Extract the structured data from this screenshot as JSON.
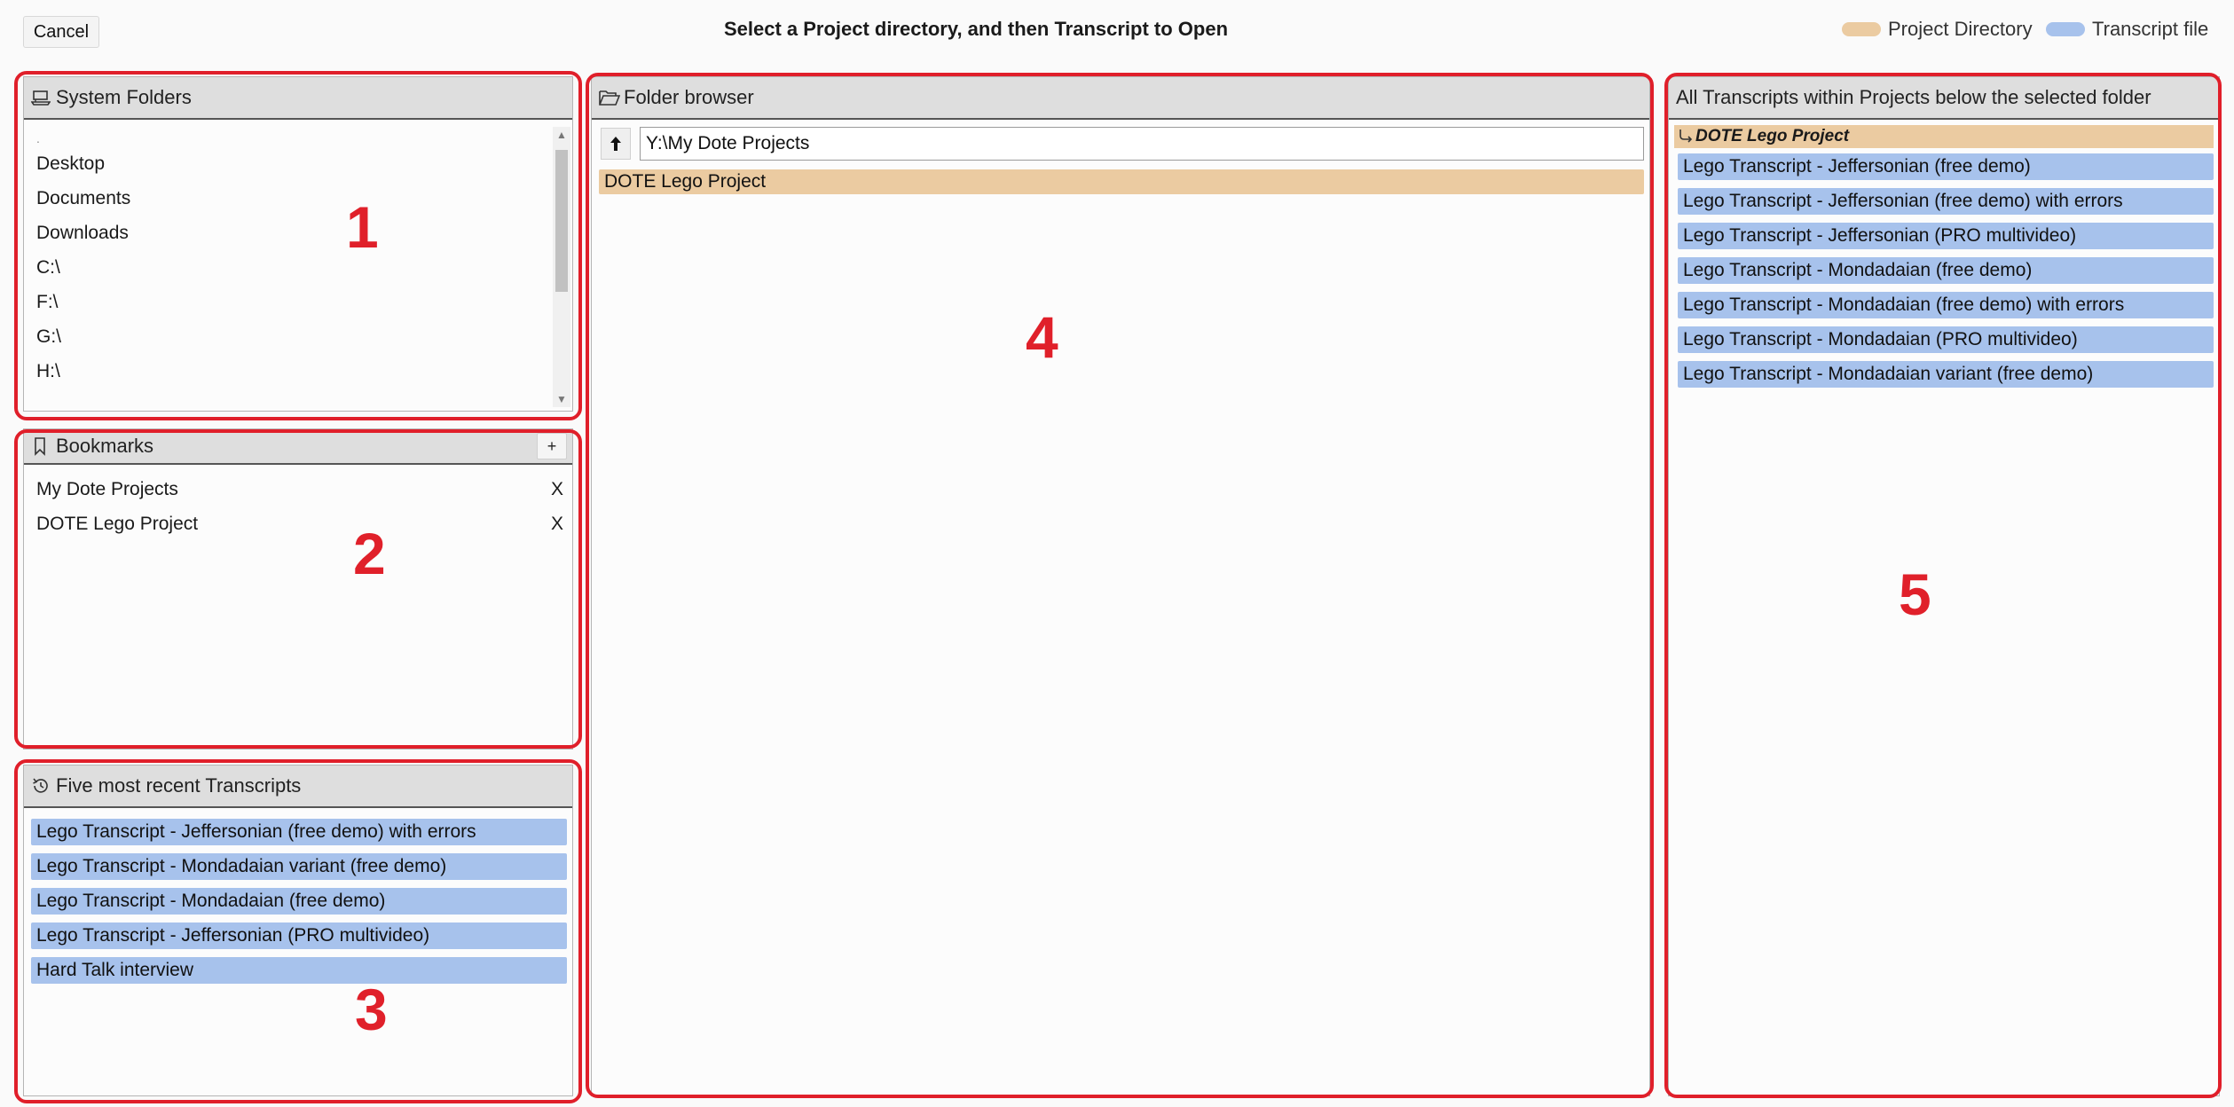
{
  "header": {
    "cancel_label": "Cancel",
    "title": "Select a Project directory, and then Transcript to Open",
    "legend": [
      {
        "label": "Project Directory",
        "color": "#ebcba1"
      },
      {
        "label": "Transcript file",
        "color": "#a7c2ec"
      }
    ]
  },
  "system_folders": {
    "title": "System Folders",
    "icon": "drive-icon",
    "items": [
      "Desktop",
      "Documents",
      "Downloads",
      "C:\\",
      "F:\\",
      "G:\\",
      "H:\\"
    ]
  },
  "bookmarks": {
    "title": "Bookmarks",
    "icon": "bookmark-icon",
    "add_label": "+",
    "remove_label": "X",
    "items": [
      "My Dote Projects",
      "DOTE Lego Project"
    ]
  },
  "recent": {
    "title": "Five most recent Transcripts",
    "icon": "history-icon",
    "items": [
      "Lego Transcript - Jeffersonian (free demo) with errors",
      "Lego Transcript - Mondadaian variant (free demo)",
      "Lego Transcript - Mondadaian (free demo)",
      "Lego Transcript - Jeffersonian (PRO multivideo)",
      "Hard Talk interview"
    ]
  },
  "folder_browser": {
    "title": "Folder browser",
    "icon": "folder-open-icon",
    "path_value": "Y:\\My Dote Projects",
    "items": [
      "DOTE Lego Project"
    ]
  },
  "transcripts": {
    "title": "All Transcripts within Projects below the selected folder",
    "project": "DOTE Lego Project",
    "project_icon": "subdirectory-arrow-icon",
    "items": [
      "Lego Transcript - Jeffersonian (free demo)",
      "Lego Transcript - Jeffersonian (free demo) with errors",
      "Lego Transcript - Jeffersonian (PRO multivideo)",
      "Lego Transcript - Mondadaian (free demo)",
      "Lego Transcript - Mondadaian (free demo) with errors",
      "Lego Transcript - Mondadaian (PRO multivideo)",
      "Lego Transcript - Mondadaian variant (free demo)"
    ]
  },
  "callouts": [
    "1",
    "2",
    "3",
    "4",
    "5"
  ]
}
